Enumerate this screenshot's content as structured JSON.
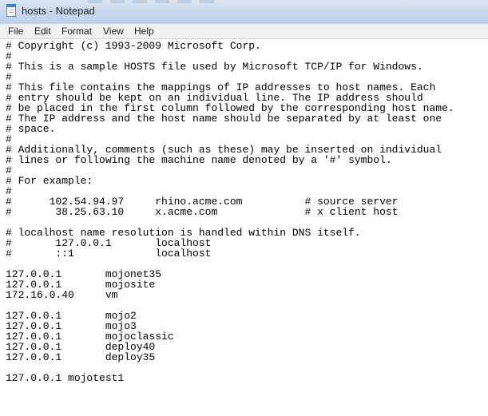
{
  "window": {
    "title": "hosts - Notepad"
  },
  "menu": {
    "items": [
      "File",
      "Edit",
      "Format",
      "View",
      "Help"
    ]
  },
  "icons": {
    "app": "notepad-icon"
  },
  "colors": {
    "titlebar": "#c9d9ec",
    "menubar": "#f0f0f0",
    "editor_bg": "#ffffff",
    "text": "#000000"
  },
  "document": {
    "lines": [
      "# Copyright (c) 1993-2009 Microsoft Corp.",
      "#",
      "# This is a sample HOSTS file used by Microsoft TCP/IP for Windows.",
      "#",
      "# This file contains the mappings of IP addresses to host names. Each",
      "# entry should be kept on an individual line. The IP address should",
      "# be placed in the first column followed by the corresponding host name.",
      "# The IP address and the host name should be separated by at least one",
      "# space.",
      "#",
      "# Additionally, comments (such as these) may be inserted on individual",
      "# lines or following the machine name denoted by a '#' symbol.",
      "#",
      "# For example:",
      "#",
      "#      102.54.94.97     rhino.acme.com          # source server",
      "#       38.25.63.10     x.acme.com              # x client host",
      "",
      "# localhost name resolution is handled within DNS itself.",
      "#\t127.0.0.1       localhost",
      "#\t::1             localhost",
      "",
      "127.0.0.1       mojonet35",
      "127.0.0.1       mojosite",
      "172.16.0.40     vm",
      "",
      "127.0.0.1       mojo2",
      "127.0.0.1       mojo3",
      "127.0.0.1       mojoclassic",
      "127.0.0.1       deploy40",
      "127.0.0.1       deploy35",
      "",
      "127.0.0.1 mojotest1"
    ]
  }
}
